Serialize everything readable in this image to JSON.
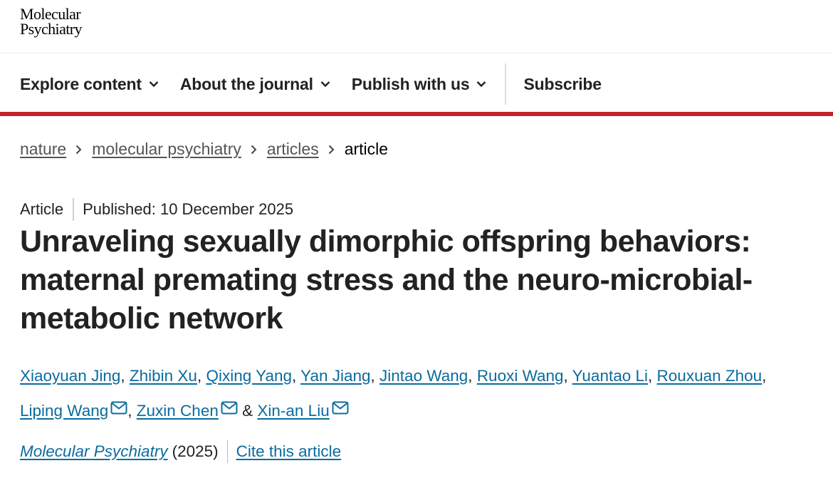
{
  "logo": {
    "line1": "Molecular",
    "line2": "Psychiatry"
  },
  "nav": {
    "items": [
      {
        "label": "Explore content"
      },
      {
        "label": "About the journal"
      },
      {
        "label": "Publish with us"
      }
    ],
    "subscribe": "Subscribe"
  },
  "breadcrumb": {
    "items": [
      "nature",
      "molecular psychiatry",
      "articles"
    ],
    "current": "article"
  },
  "article": {
    "type": "Article",
    "published": "Published: 10 December 2025",
    "title": "Unraveling sexually dimorphic offspring behaviors: maternal premating stress and the neuro-microbial-metabolic network",
    "authors": [
      "Xiaoyuan Jing",
      "Zhibin Xu",
      "Qixing Yang",
      "Yan Jiang",
      "Jintao Wang",
      "Ruoxi Wang",
      "Yuantao Li",
      "Rouxuan Zhou",
      "Liping Wang",
      "Zuxin Chen",
      "Xin-an Liu"
    ],
    "separators": {
      "comma": ",",
      "amp": "&"
    },
    "journal": "Molecular Psychiatry",
    "year": "(2025)",
    "cite": "Cite this article"
  },
  "colors": {
    "accent_red": "#c4232d",
    "link_blue": "#0a6c9e",
    "text": "#222222"
  },
  "icons": {
    "chevron": "chevron-down-icon",
    "breadcrumb_sep": "chevron-right-icon",
    "mail": "mail-icon"
  }
}
